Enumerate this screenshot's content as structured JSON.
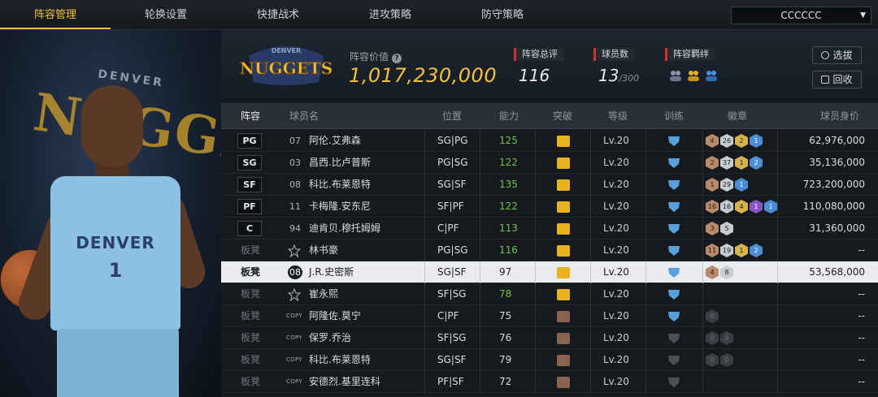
{
  "nav": {
    "tabs": [
      "阵容管理",
      "轮换设置",
      "快捷战术",
      "进攻策略",
      "防守策略"
    ],
    "active_index": 0,
    "team_select_value": "CCCCCC"
  },
  "player_art": {
    "bg_text": "NUGGETS",
    "top_text": "DENVER",
    "jersey_team": "DENVER",
    "jersey_number": "1"
  },
  "header": {
    "logo_top": "DENVER",
    "logo_text": "NUGGETS",
    "value_label": "阵容价值",
    "value_help": "?",
    "value": "1,017,230,000",
    "stats": [
      {
        "label": "阵容总评",
        "value": "116",
        "suffix": ""
      },
      {
        "label": "球员数",
        "value": "13",
        "suffix": "/300"
      },
      {
        "label": "阵容羁绊",
        "value": "",
        "suffix": ""
      }
    ],
    "buttons": {
      "select": "选拔",
      "recycle": "回收"
    },
    "colors": {
      "accent": "#f0c040",
      "tag_bar": "#d32f2f"
    }
  },
  "table": {
    "headers": [
      "阵容",
      "球员名",
      "位置",
      "能力",
      "突破",
      "等级",
      "训练",
      "徽章",
      "球员身价"
    ],
    "rows": [
      {
        "slot": "PG",
        "jersey": "07",
        "name": "阿伦.艾弗森",
        "pos": "SG|PG",
        "ability": "125",
        "ability_color": "green",
        "breakthrough": "gold",
        "level": "Lv.20",
        "training": "blue",
        "badges": [
          [
            "bronze",
            "4"
          ],
          [
            "silver",
            "26"
          ],
          [
            "gold",
            "2"
          ],
          [
            "blue",
            "1"
          ]
        ],
        "salary": "62,976,000"
      },
      {
        "slot": "SG",
        "jersey": "03",
        "name": "昌西.比卢普斯",
        "pos": "PG|SG",
        "ability": "122",
        "ability_color": "green",
        "breakthrough": "gold",
        "level": "Lv.20",
        "training": "blue",
        "badges": [
          [
            "bronze",
            "2"
          ],
          [
            "silver",
            "37"
          ],
          [
            "gold",
            "1"
          ],
          [
            "blue",
            "2"
          ]
        ],
        "salary": "35,136,000"
      },
      {
        "slot": "SF",
        "jersey": "08",
        "name": "科比.布莱恩特",
        "pos": "SG|SF",
        "ability": "135",
        "ability_color": "green",
        "breakthrough": "gold",
        "level": "Lv.20",
        "training": "blue",
        "badges": [
          [
            "bronze",
            "1"
          ],
          [
            "silver",
            "29"
          ],
          [
            "blue",
            "1"
          ]
        ],
        "salary": "723,200,000"
      },
      {
        "slot": "PF",
        "jersey": "11",
        "name": "卡梅隆.安东尼",
        "pos": "SF|PF",
        "ability": "122",
        "ability_color": "green",
        "breakthrough": "gold6",
        "level": "Lv.20",
        "training": "blue",
        "badges": [
          [
            "bronze",
            "16"
          ],
          [
            "silver",
            "16"
          ],
          [
            "gold",
            "4"
          ],
          [
            "purple",
            "1"
          ],
          [
            "blue",
            "1"
          ]
        ],
        "salary": "110,080,000"
      },
      {
        "slot": "C",
        "jersey": "94",
        "name": "迪肯贝.穆托姆姆",
        "pos": "C|PF",
        "ability": "113",
        "ability_color": "green",
        "breakthrough": "gold",
        "level": "Lv.20",
        "training": "blue",
        "badges": [
          [
            "bronze",
            "3"
          ],
          [
            "silver",
            "5"
          ]
        ],
        "salary": "31,360,000"
      },
      {
        "slot": "板凳",
        "jersey": "",
        "name": "林书豪",
        "pos": "PG|SG",
        "ability": "116",
        "ability_color": "green",
        "breakthrough": "gold",
        "level": "Lv.20",
        "training": "blue",
        "badges": [
          [
            "bronze",
            "11"
          ],
          [
            "silver",
            "19"
          ],
          [
            "gold",
            "1"
          ],
          [
            "blue",
            "2"
          ]
        ],
        "salary": "--"
      },
      {
        "slot": "板凳",
        "jersey": "08",
        "name": "J.R.史密斯",
        "pos": "SG|SF",
        "ability": "97",
        "ability_color": "plain",
        "breakthrough": "gold",
        "level": "Lv.20",
        "training": "blue",
        "badges": [
          [
            "bronze",
            "4"
          ],
          [
            "silver",
            "8"
          ]
        ],
        "salary": "53,568,000",
        "selected": true
      },
      {
        "slot": "板凳",
        "jersey": "",
        "name": "崔永熙",
        "pos": "SF|SG",
        "ability": "78",
        "ability_color": "green",
        "breakthrough": "gold",
        "level": "Lv.20",
        "training": "blue",
        "badges": [],
        "salary": "--"
      },
      {
        "slot": "板凳",
        "jersey": "COPY",
        "name": "阿隆佐.莫宁",
        "pos": "C|PF",
        "ability": "75",
        "ability_color": "plain",
        "breakthrough": "brown1",
        "level": "Lv.20",
        "training": "blue1",
        "badges": [
          [
            "dark",
            "0"
          ]
        ],
        "salary": "--"
      },
      {
        "slot": "板凳",
        "jersey": "COPY",
        "name": "保罗.乔治",
        "pos": "SF|SG",
        "ability": "76",
        "ability_color": "plain",
        "breakthrough": "brown1",
        "level": "Lv.20",
        "training": "dark",
        "badges": [
          [
            "dark",
            "0"
          ],
          [
            "dark",
            "0"
          ]
        ],
        "salary": "--"
      },
      {
        "slot": "板凳",
        "jersey": "COPY",
        "name": "科比.布莱恩特",
        "pos": "SG|SF",
        "ability": "79",
        "ability_color": "plain",
        "breakthrough": "brown1",
        "level": "Lv.20",
        "training": "dark",
        "badges": [
          [
            "dark",
            "0"
          ],
          [
            "dark",
            "0"
          ]
        ],
        "salary": "--"
      },
      {
        "slot": "板凳",
        "jersey": "COPY",
        "name": "安德烈.基里连科",
        "pos": "PF|SF",
        "ability": "72",
        "ability_color": "plain",
        "breakthrough": "brown1",
        "level": "Lv.20",
        "training": "dark",
        "badges": [],
        "salary": "--"
      }
    ]
  }
}
